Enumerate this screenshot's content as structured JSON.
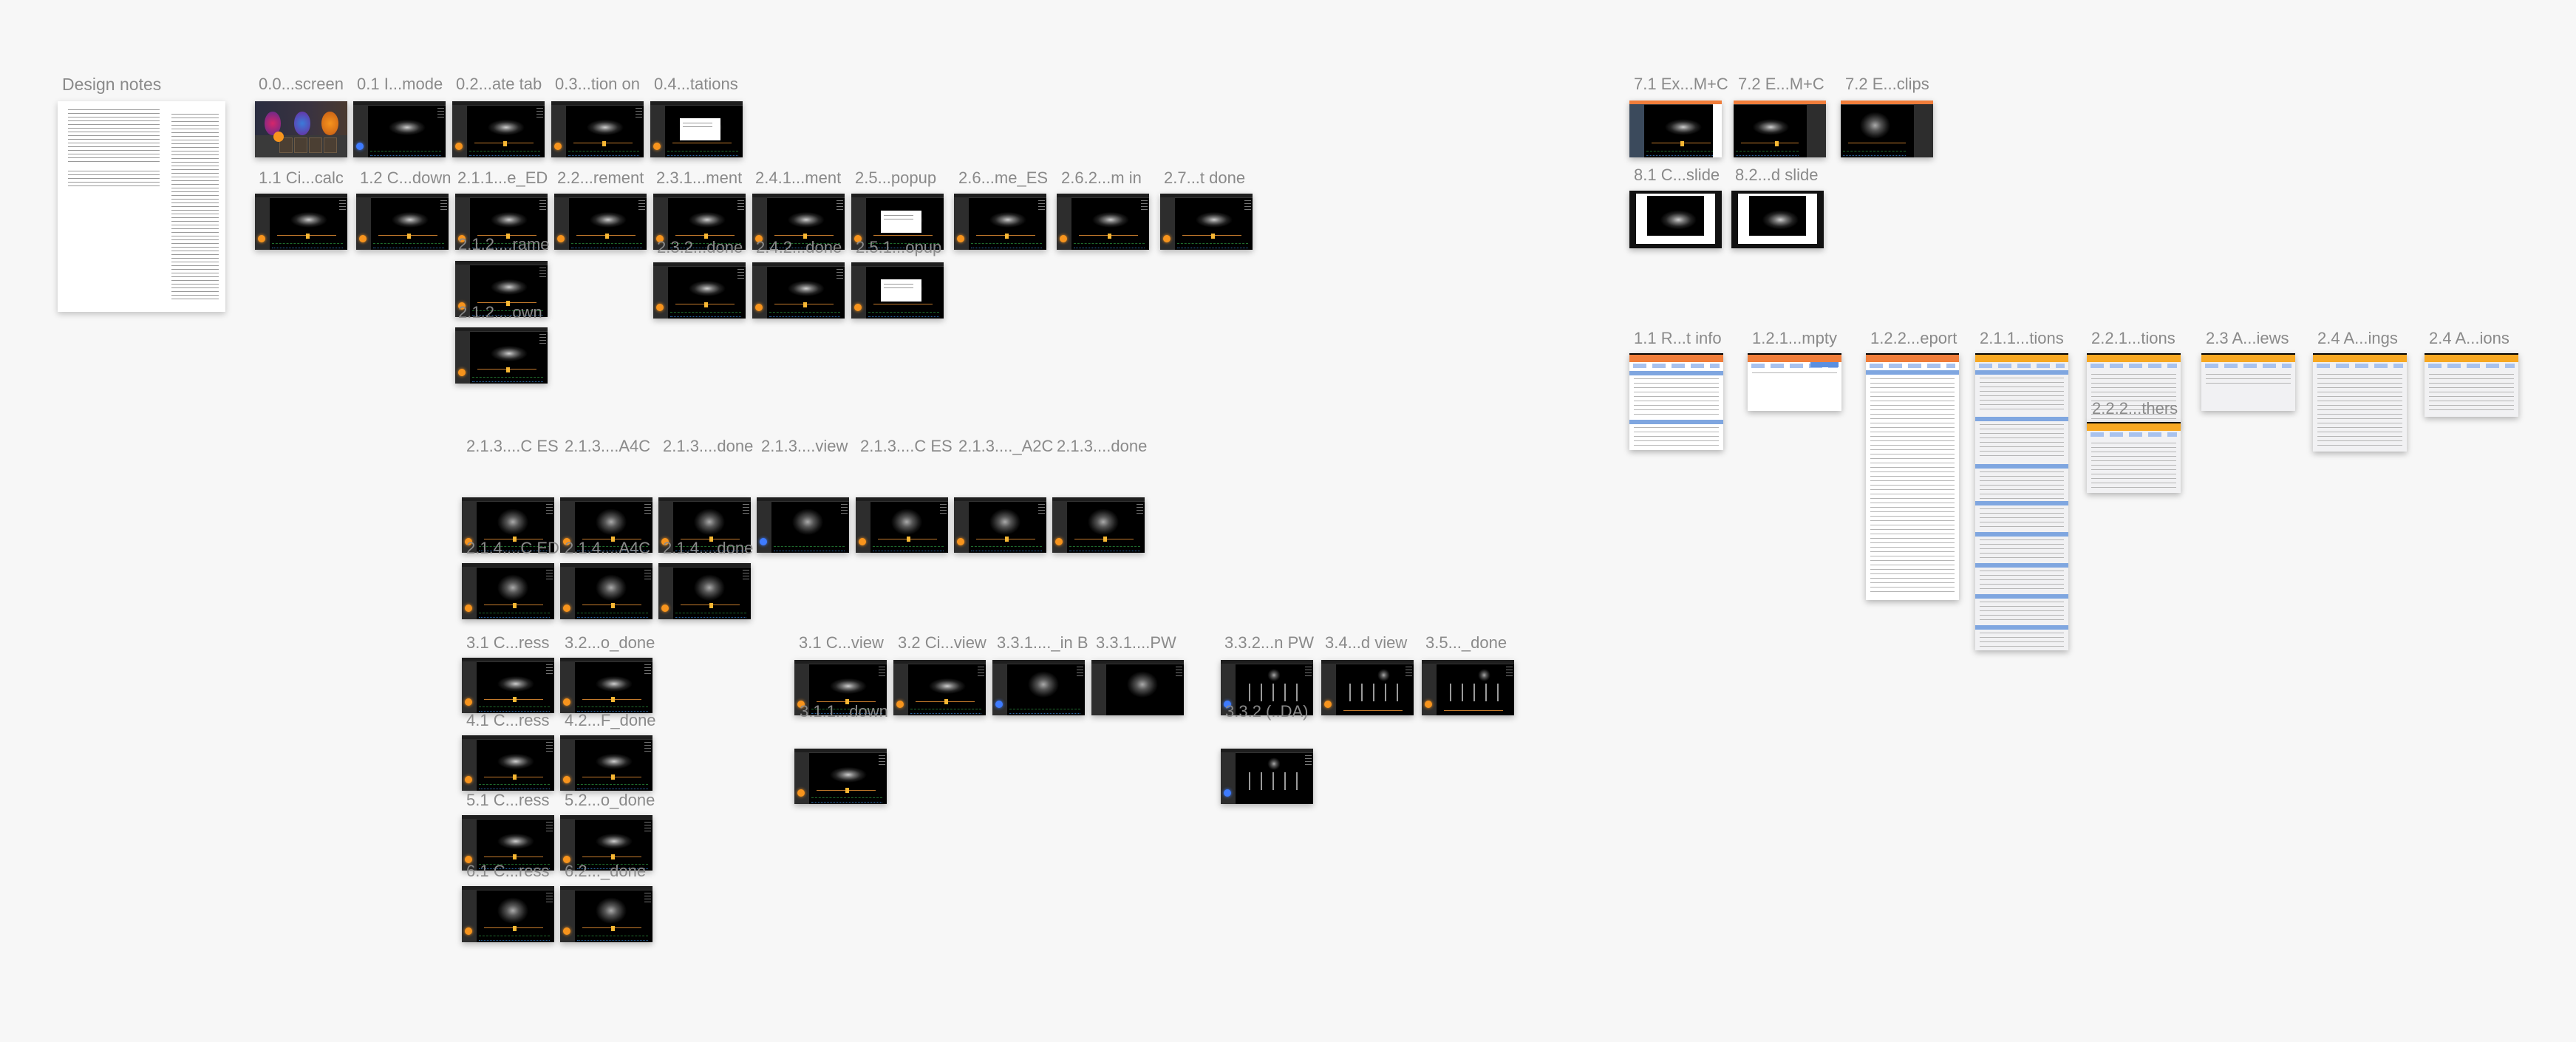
{
  "canvas": {
    "background": "#f7f7f7",
    "accent_orange": "#f7941d",
    "report_header_orange": "#f07d3a",
    "report_header_amber": "#f7a823",
    "report_section_blue": "#7fa6e0"
  },
  "design_notes": {
    "label": "Design notes",
    "sections": [
      "Design Notes",
      "Questions",
      "Relevant studies",
      "Target User Groups for Release – regular",
      "Target User Groups for Release 1P – Educational",
      "Target User Groups for Release 1P – Clinical"
    ]
  },
  "frames": {
    "f00": "0.0...screen",
    "f01": "0.1 I...mode",
    "f02": "0.2...ate tab",
    "f03": "0.3...tion on",
    "f04": "0.4...tations",
    "f11": "1.1 Ci...calc",
    "f12": "1.2 C...down",
    "f211": "2.1.1...e_ED",
    "f212a": "2.1.2....rame",
    "f212b": "2.1.2....own",
    "f22": "2.2...rement",
    "f231": "2.3.1...ment",
    "f232": "2.3.2...done",
    "f241": "2.4.1...ment",
    "f242": "2.4.2...done",
    "f25": "2.5...popup",
    "f251": "2.5.1...opup",
    "f26": "2.6...me_ES",
    "f262": "2.6.2...m in",
    "f27": "2.7...t done",
    "f213a": "2.1.3....C ES",
    "f213b": "2.1.3....A4C",
    "f213c": "2.1.3....done",
    "f213d": "2.1.3....view",
    "f213e": "2.1.3....C ES",
    "f213f": "2.1.3...._A2C",
    "f213g": "2.1.3....done",
    "f214a": "2.1.4....C ED",
    "f214b": "2.1.4....A4C",
    "f214c": "2.1.4....done",
    "f31p": "3.1 C...ress",
    "f32d": "3.2...o_done",
    "f41": "4.1 C...ress",
    "f42": "4.2...F_done",
    "f51": "5.1 C...ress",
    "f52": "5.2...o_done",
    "f61": "6.1 C...ress",
    "f62": "6.2..._done",
    "f31v": "3.1 C...view",
    "f311": "3.1.1...down",
    "f32v": "3.2 Ci...view",
    "f331b": "3.3.1...._in B",
    "f331pw": "3.3.1....PW",
    "f332": "3.3.2...n PW",
    "f332da": "3.3.2 (..DA)",
    "f34": "3.4...d view",
    "f35": "3.5..._done",
    "f71": "7.1 Ex...M+C",
    "f72a": "7.2 E...M+C",
    "f72b": "7.2 E...clips",
    "f81": "8.1 C...slide",
    "f82": "8.2...d slide",
    "r11": "1.1 R...t info",
    "r121": "1.2.1...mpty",
    "r122": "1.2.2...eport",
    "r211": "2.1.1...tions",
    "r221": "2.2.1...tions",
    "r222": "2.2.2...thers",
    "r23": "2.3 A...iews",
    "r24f": "2.4 A...ings",
    "r24i": "2.4 A...ions"
  }
}
